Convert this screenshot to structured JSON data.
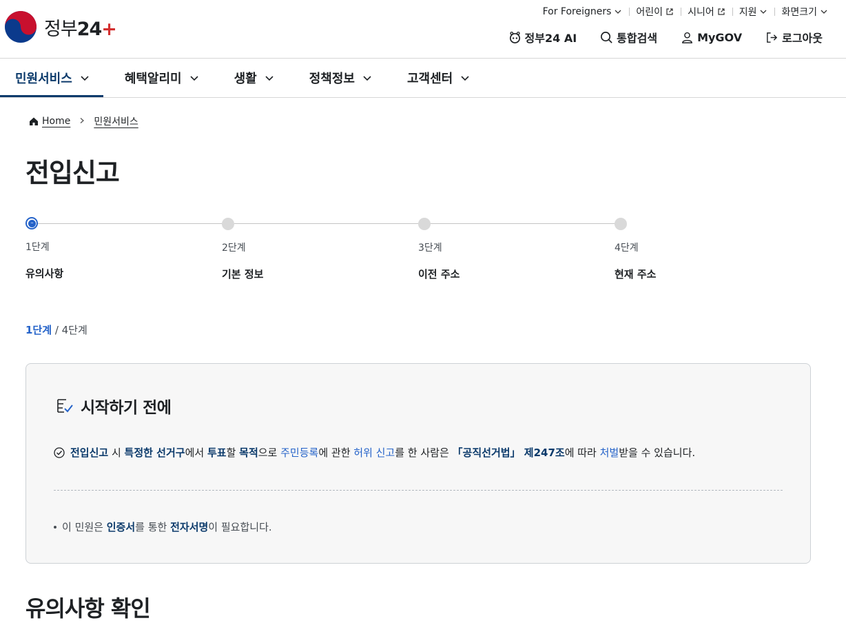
{
  "header": {
    "logo": {
      "text_main": "정부",
      "text_num": "24",
      "text_plus": "+"
    },
    "util": [
      {
        "label": "For Foreigners",
        "icon": "chevron-down-icon"
      },
      {
        "label": "어린이",
        "icon": "external-link-icon"
      },
      {
        "label": "시니어",
        "icon": "external-link-icon"
      },
      {
        "label": "지원",
        "icon": "chevron-down-icon"
      },
      {
        "label": "화면크기",
        "icon": "chevron-down-icon"
      }
    ],
    "gnb": [
      {
        "label": "정부24 AI",
        "icon": "ai-bot-icon"
      },
      {
        "label": "통합검색",
        "icon": "search-icon"
      },
      {
        "label": "MyGOV",
        "icon": "user-icon"
      },
      {
        "label": "로그아웃",
        "icon": "logout-icon"
      }
    ]
  },
  "mainnav": {
    "tabs": [
      {
        "label": "민원서비스"
      },
      {
        "label": "혜택알리미"
      },
      {
        "label": "생활"
      },
      {
        "label": "정책정보"
      },
      {
        "label": "고객센터"
      }
    ]
  },
  "breadcrumb": {
    "home": "Home",
    "current": "민원서비스"
  },
  "page": {
    "title": "전입신고"
  },
  "stepper": {
    "steps": [
      {
        "num": "1단계",
        "name": "유의사항",
        "state": "current"
      },
      {
        "num": "2단계",
        "name": "기본 정보",
        "state": "pending"
      },
      {
        "num": "3단계",
        "name": "이전 주소",
        "state": "pending"
      },
      {
        "num": "4단계",
        "name": "현재 주소",
        "state": "pending"
      }
    ],
    "count_current": "1단계",
    "count_sep": " / ",
    "count_total": "4단계"
  },
  "infobox": {
    "title": "시작하기 전에",
    "notice": {
      "p1": "전입신고",
      "p2": " 시 ",
      "p3": "특정한 선거구",
      "p4": "에서 ",
      "p5": "투표",
      "p6": "할 ",
      "p7": "목적",
      "p8": "으로 ",
      "p9": "주민등록",
      "p10": "에 관한 ",
      "p11": "허위 신고",
      "p12": "를 한 사람은 ",
      "p13": "「공직선거법」 제247조",
      "p14": "에 따라 ",
      "p15": "처벌",
      "p16": "받을 수 있습니다."
    },
    "bullet": {
      "p1": "이 민원은 ",
      "p2": "인증서",
      "p3": "를 통한 ",
      "p4": "전자서명",
      "p5": "이 필요합니다."
    }
  },
  "section": {
    "title": "유의사항 확인"
  },
  "colors": {
    "primary": "#0b3a6b",
    "link": "#2563c9",
    "box_bg": "#f7f7f7"
  }
}
